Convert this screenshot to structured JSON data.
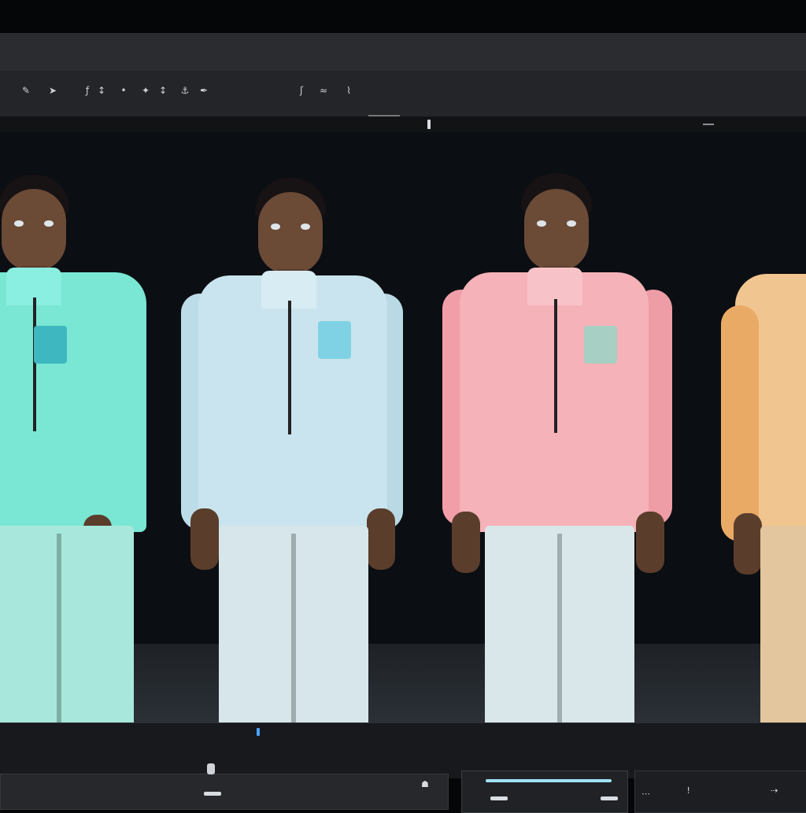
{
  "menu": {
    "items": [
      "",
      "",
      ""
    ]
  },
  "toolbar": {
    "icons": [
      "brush-icon",
      "pointer-icon",
      "text-icon",
      "transform-icon",
      "dot-icon",
      "sparkle-icon",
      "arrow-icon",
      "anchor-icon",
      "pen-icon",
      "script-icon",
      "wave-icon",
      "field-icon"
    ]
  },
  "viewport": {
    "figures": [
      {
        "label": "figure-mint",
        "jacket_color": "#79e7d3",
        "pants_color": "#a8e8dc"
      },
      {
        "label": "figure-sky",
        "jacket_color": "#c9e4ee",
        "pants_color": "#d6e6ea"
      },
      {
        "label": "figure-pink",
        "jacket_color": "#f5b2b8",
        "pants_color": "#d9e7ea"
      },
      {
        "label": "figure-peach",
        "jacket_color": "#f1c58f",
        "pants_color": "#e3c69e"
      }
    ]
  },
  "timeline": {
    "playhead_progress": 0.32
  },
  "colors": {
    "accent": "#4aa3ff",
    "slider": "#9fe2f2"
  }
}
